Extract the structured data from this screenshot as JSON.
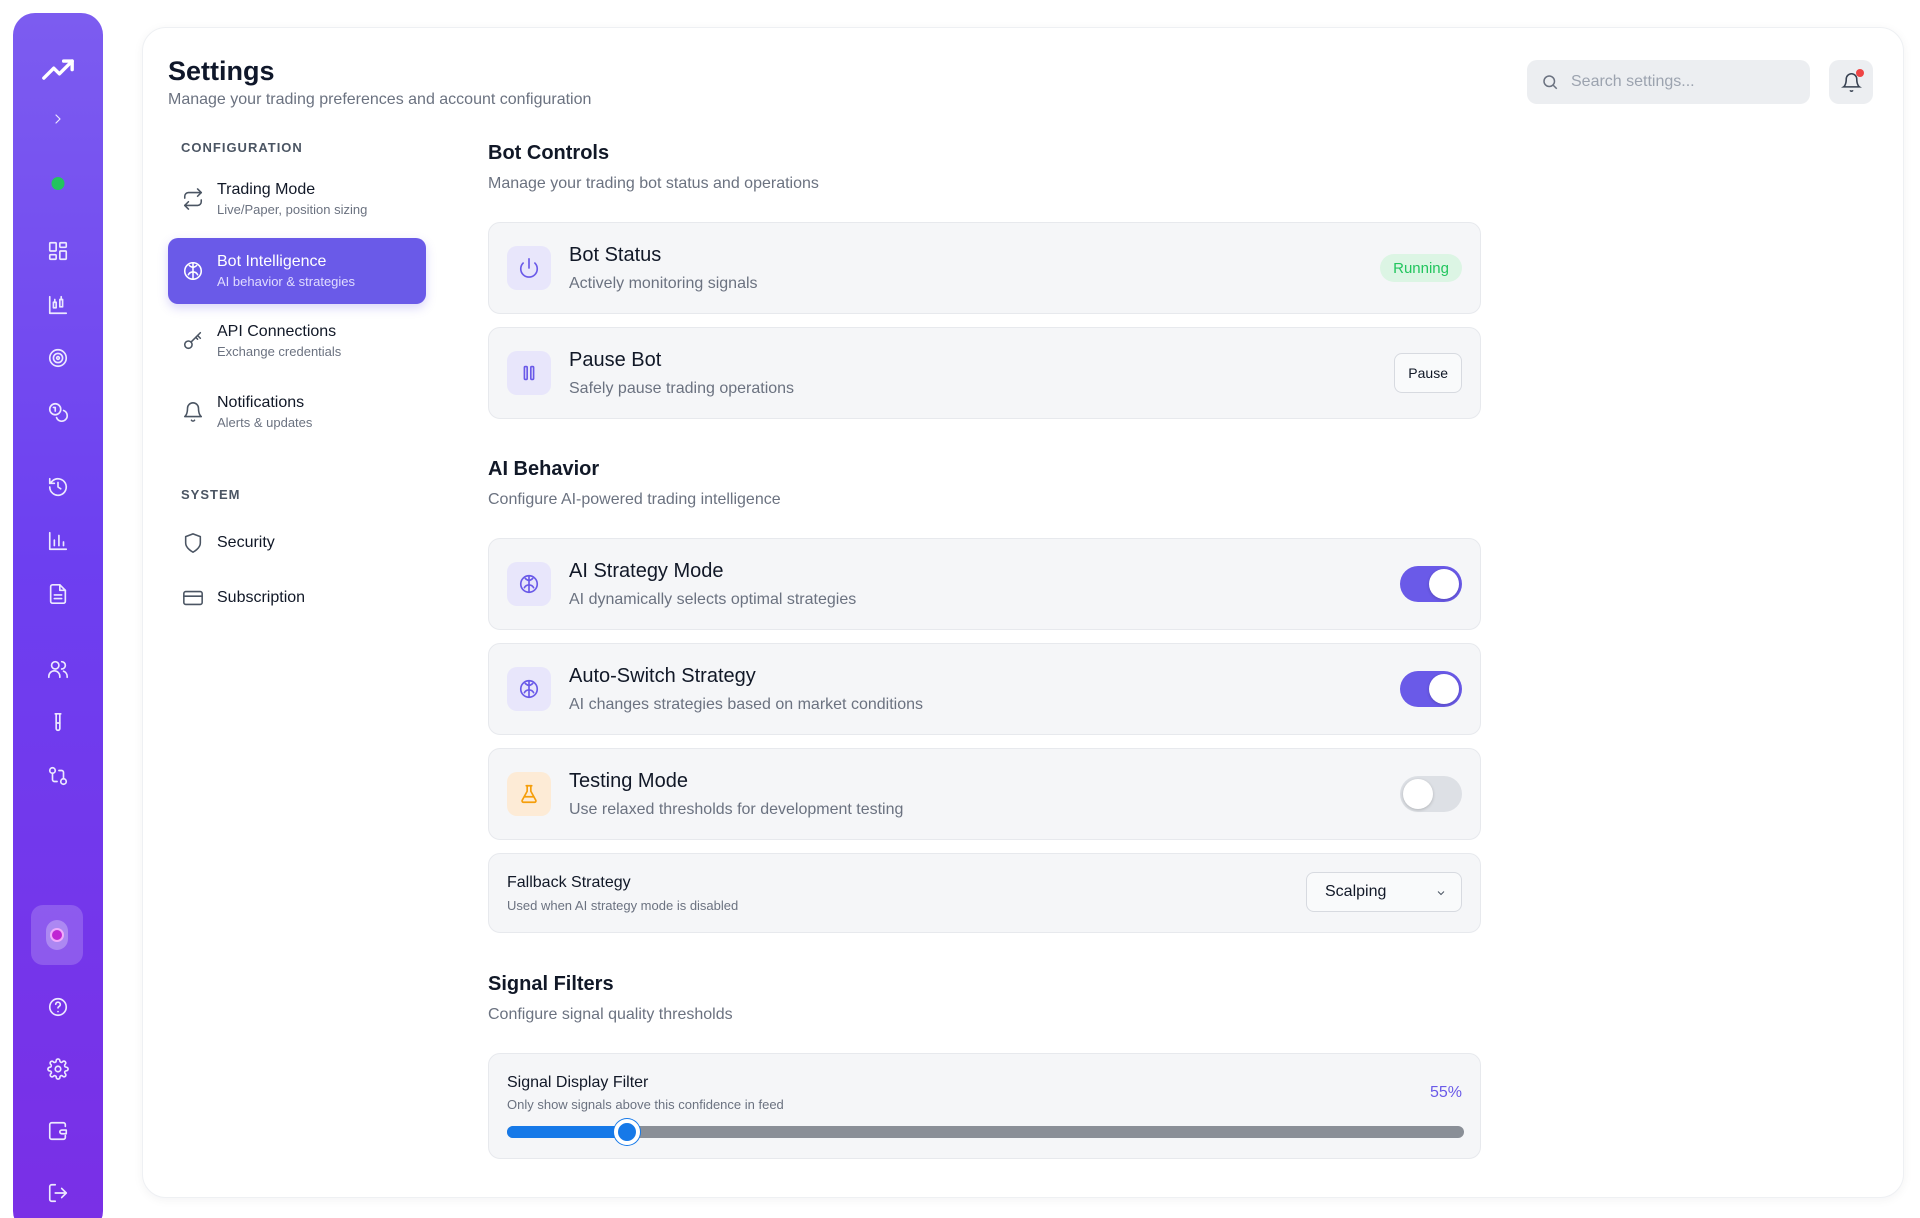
{
  "rail": {
    "items": [
      {
        "name": "trend-logo-icon"
      },
      {
        "name": "chevron-right-icon"
      },
      {
        "name": "dashboard-grid-icon"
      },
      {
        "name": "chart-candles-icon"
      },
      {
        "name": "target-icon"
      },
      {
        "name": "coins-icon"
      },
      {
        "name": "history-icon"
      },
      {
        "name": "bar-chart-icon"
      },
      {
        "name": "document-icon"
      },
      {
        "name": "users-icon"
      },
      {
        "name": "test-tube-icon"
      },
      {
        "name": "git-compare-icon"
      },
      {
        "name": "help-icon"
      },
      {
        "name": "gear-icon"
      },
      {
        "name": "wallet-icon"
      },
      {
        "name": "logout-icon"
      }
    ],
    "status_color": "#22c55e"
  },
  "header": {
    "title": "Settings",
    "subtitle": "Manage your trading preferences and account configuration",
    "search_placeholder": "Search settings..."
  },
  "nav": {
    "configuration_heading": "CONFIGURATION",
    "system_heading": "SYSTEM",
    "items": [
      {
        "label": "Trading Mode",
        "desc": "Live/Paper, position sizing"
      },
      {
        "label": "Bot Intelligence",
        "desc": "AI behavior & strategies"
      },
      {
        "label": "API Connections",
        "desc": "Exchange credentials"
      },
      {
        "label": "Notifications",
        "desc": "Alerts & updates"
      },
      {
        "label": "Security"
      },
      {
        "label": "Subscription"
      }
    ],
    "active_index": 1
  },
  "bot_controls": {
    "title": "Bot Controls",
    "subtitle": "Manage your trading bot status and operations",
    "status": {
      "title": "Bot Status",
      "desc": "Actively monitoring signals",
      "badge": "Running"
    },
    "pause": {
      "title": "Pause Bot",
      "desc": "Safely pause trading operations",
      "button": "Pause"
    }
  },
  "ai_behavior": {
    "title": "AI Behavior",
    "subtitle": "Configure AI-powered trading intelligence",
    "strategy_mode": {
      "title": "AI Strategy Mode",
      "desc": "AI dynamically selects optimal strategies",
      "enabled": true
    },
    "auto_switch": {
      "title": "Auto-Switch Strategy",
      "desc": "AI changes strategies based on market conditions",
      "enabled": true
    },
    "testing_mode": {
      "title": "Testing Mode",
      "desc": "Use relaxed thresholds for development testing",
      "enabled": false
    },
    "fallback": {
      "title": "Fallback Strategy",
      "desc": "Used when AI strategy mode is disabled",
      "value": "Scalping"
    }
  },
  "signal_filters": {
    "title": "Signal Filters",
    "subtitle": "Configure signal quality thresholds",
    "display_filter": {
      "title": "Signal Display Filter",
      "desc": "Only show signals above this confidence in feed",
      "value_label": "55%",
      "value": 55,
      "min": 0,
      "max": 100
    }
  },
  "colors": {
    "accent": "#6a5ae8",
    "running": "#22c55e",
    "slider": "#1679e8"
  }
}
